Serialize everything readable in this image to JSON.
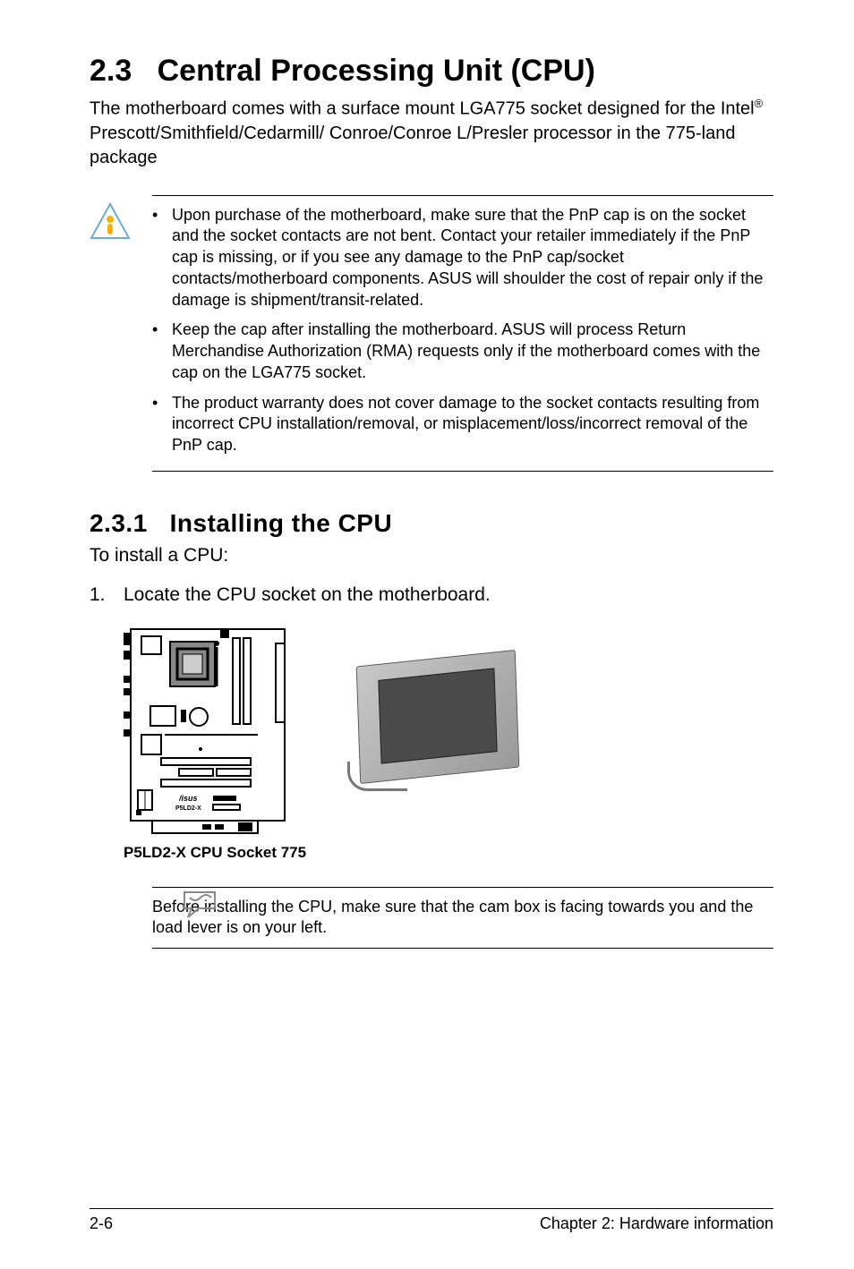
{
  "heading": {
    "number": "2.3",
    "title": "Central Processing Unit (CPU)"
  },
  "intro": {
    "pre": "The motherboard comes with a surface mount LGA775 socket designed for the Intel",
    "sup": "®",
    "post": " Prescott/Smithfield/Cedarmill/ Conroe/Conroe L/Presler processor in the 775-land package"
  },
  "caution_bullets": [
    "Upon purchase of the motherboard, make sure that the PnP cap is on the socket and the socket contacts are not bent. Contact your retailer immediately if the PnP cap is missing, or if you see any damage to the PnP cap/socket contacts/motherboard components. ASUS will shoulder the cost of repair only if the damage is shipment/transit-related.",
    "Keep the cap after installing the motherboard. ASUS will process Return Merchandise Authorization (RMA) requests only if the motherboard comes with the cap on the LGA775 socket.",
    "The product warranty does not cover damage to the socket contacts resulting from incorrect CPU installation/removal, or misplacement/loss/incorrect removal of the PnP cap."
  ],
  "subheading": {
    "number": "2.3.1",
    "title": "Installing the CPU"
  },
  "lead_in": "To install a CPU:",
  "step1": {
    "num": "1.",
    "text": "Locate the CPU socket on the motherboard."
  },
  "board_label": "P5LD2-X",
  "figure_caption": "P5LD2-X CPU Socket 775",
  "tip_text": "Before installing the CPU, make sure that the cam box is facing towards you and the load lever is on your left.",
  "footer": {
    "left": "2-6",
    "right": "Chapter 2: Hardware information"
  }
}
